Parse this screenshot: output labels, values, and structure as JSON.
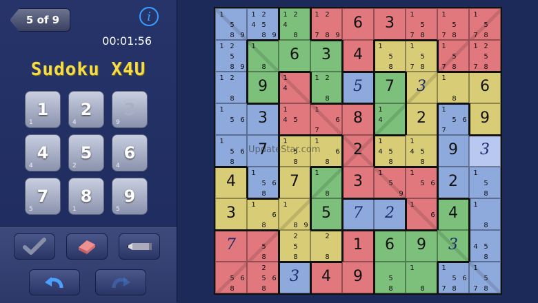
{
  "header": {
    "back_label": "5 of 9",
    "info_label": "i",
    "timer": "00:01:56"
  },
  "app_title": "Sudoku X4U",
  "keypad": [
    {
      "label": "1",
      "count": "1",
      "dim": false
    },
    {
      "label": "2",
      "count": "4",
      "dim": false
    },
    {
      "label": "3",
      "count": "9",
      "dim": true
    },
    {
      "label": "4",
      "count": "4",
      "dim": false
    },
    {
      "label": "5",
      "count": "2",
      "dim": false
    },
    {
      "label": "6",
      "count": "4",
      "dim": false
    },
    {
      "label": "7",
      "count": "5",
      "dim": false
    },
    {
      "label": "8",
      "count": "1",
      "dim": false
    },
    {
      "label": "9",
      "count": "5",
      "dim": false
    }
  ],
  "toolbar": [
    "check-icon",
    "eraser-icon",
    "pencil-icon",
    "undo-icon",
    "redo-icon"
  ],
  "watermark": "UpdateStar.com",
  "colors": {
    "red": "#e0787e",
    "blue": "#8eaadc",
    "green": "#7cc07c",
    "yellow": "#d8cc76",
    "highlight": "#b8c8f0"
  },
  "region_colors": [
    "BBGRRRRRR",
    "BGGGRYYRR",
    "BGRGBGYYY",
    "BBRRRGYBY",
    "BBYYRYYBB",
    "YBYGRRRBB",
    "YYYGBBRGB",
    "RRYYRGGGB",
    "RRBRRGGBB"
  ],
  "highlight_cells": [
    [
      4,
      8
    ]
  ],
  "board": [
    [
      {
        "c": "1589"
      },
      {
        "c": "124589"
      },
      {
        "c": "1248"
      },
      {
        "c": "12789"
      },
      {
        "v": "6"
      },
      {
        "v": "3"
      },
      {
        "c": "1578"
      },
      {
        "c": "1578"
      },
      {
        "c": "1578"
      }
    ],
    [
      {
        "c": "12589"
      },
      {
        "c": "18"
      },
      {
        "v": "6"
      },
      {
        "v": "3"
      },
      {
        "v": "4"
      },
      {
        "c": "158"
      },
      {
        "c": "1578"
      },
      {
        "c": "1578"
      },
      {
        "c": "12578"
      }
    ],
    [
      {
        "c": "128"
      },
      {
        "v": "9"
      },
      {
        "c": "14"
      },
      {
        "c": "128"
      },
      {
        "v": "5",
        "u": true
      },
      {
        "v": "7"
      },
      {
        "v": "3",
        "u": true
      },
      {
        "c": "18"
      },
      {
        "v": "6"
      }
    ],
    [
      {
        "c": "156"
      },
      {
        "v": "3"
      },
      {
        "c": "145"
      },
      {
        "c": "167"
      },
      {
        "v": "8"
      },
      {
        "c": "14"
      },
      {
        "v": "2"
      },
      {
        "c": "1567"
      },
      {
        "v": "9"
      }
    ],
    [
      {
        "c": "1568"
      },
      {
        "v": "7"
      },
      {
        "c": "158"
      },
      {
        "c": "168"
      },
      {
        "v": "2"
      },
      {
        "c": "1458"
      },
      {
        "c": "1458"
      },
      {
        "v": "9"
      },
      {
        "v": "3",
        "u": true
      }
    ],
    [
      {
        "v": "4"
      },
      {
        "c": "1568"
      },
      {
        "v": "7"
      },
      {
        "c": "18"
      },
      {
        "v": "3"
      },
      {
        "c": "159"
      },
      {
        "c": "156"
      },
      {
        "v": "2"
      },
      {
        "c": "158"
      }
    ],
    [
      {
        "v": "3"
      },
      {
        "c": "168"
      },
      {
        "c": "189"
      },
      {
        "v": "5"
      },
      {
        "v": "7",
        "u": true
      },
      {
        "v": "2",
        "u": true
      },
      {
        "c": "16"
      },
      {
        "v": "4"
      },
      {
        "c": "18"
      }
    ],
    [
      {
        "v": "7",
        "u": true
      },
      {
        "c": "58"
      },
      {
        "c": "258"
      },
      {
        "c": "28"
      },
      {
        "v": "1"
      },
      {
        "v": "6"
      },
      {
        "v": "9"
      },
      {
        "v": "3",
        "u": true
      },
      {
        "c": "458"
      }
    ],
    [
      {
        "c": "568"
      },
      {
        "c": "2568"
      },
      {
        "v": "3",
        "u": true
      },
      {
        "v": "4"
      },
      {
        "v": "9"
      },
      {
        "c": "58"
      },
      {
        "c": "18"
      },
      {
        "c": "15678"
      },
      {
        "c": "1578"
      }
    ]
  ]
}
